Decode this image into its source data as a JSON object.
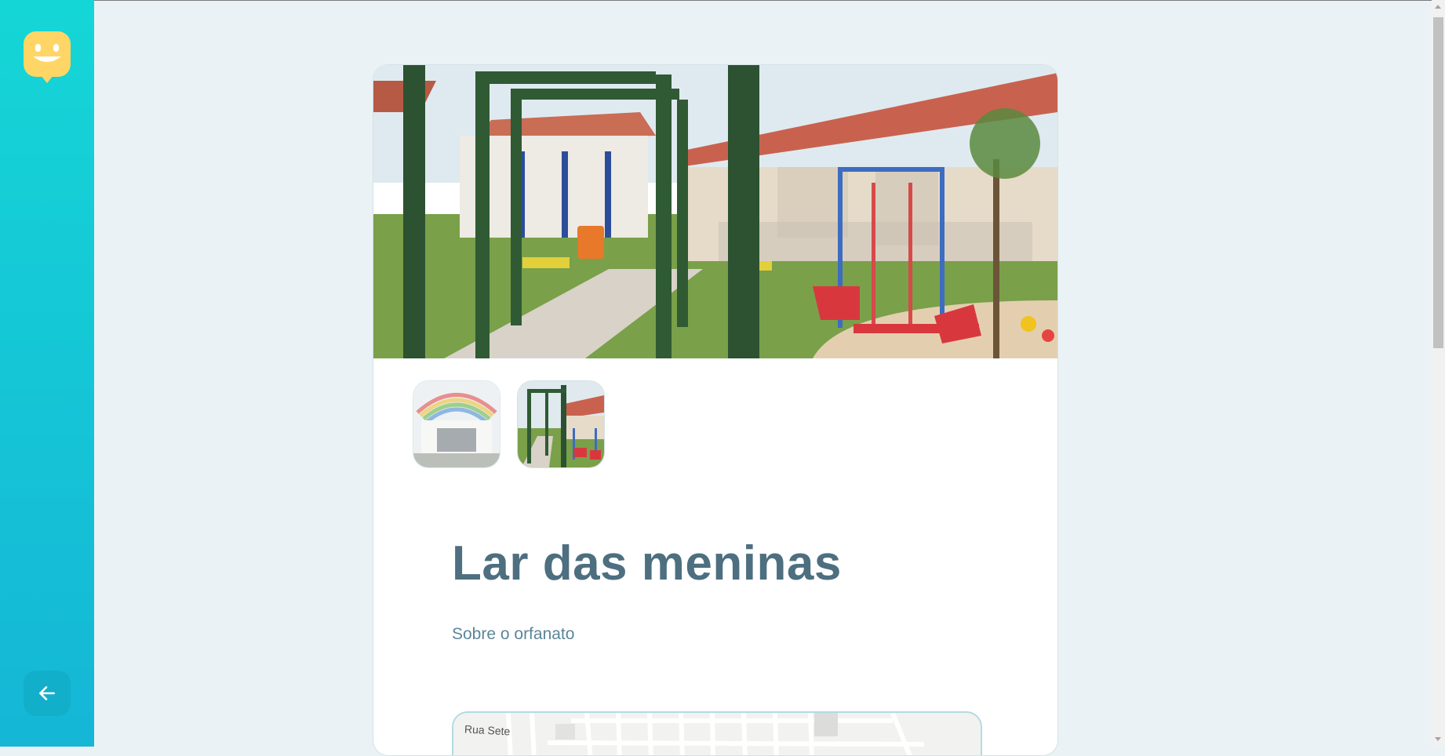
{
  "sidebar": {
    "logo_icon": "happy-face-pin-icon",
    "back_icon": "arrow-left-icon",
    "colors": {
      "gradient_top": "#15d6d6",
      "gradient_bottom": "#15b6d6",
      "logo": "#ffd666"
    }
  },
  "orphanage": {
    "name": "Lar das meninas",
    "about": "Sobre o orfanato",
    "images": [
      {
        "description_icon": "building-with-rainbow-photo",
        "active": false
      },
      {
        "description_icon": "playground-with-pergola-photo",
        "active": true
      }
    ]
  },
  "map": {
    "street_label": "Rua Sete"
  },
  "colors": {
    "title": "#4d6f80",
    "subtitle": "#5c8599",
    "background": "#ebf2f5"
  }
}
